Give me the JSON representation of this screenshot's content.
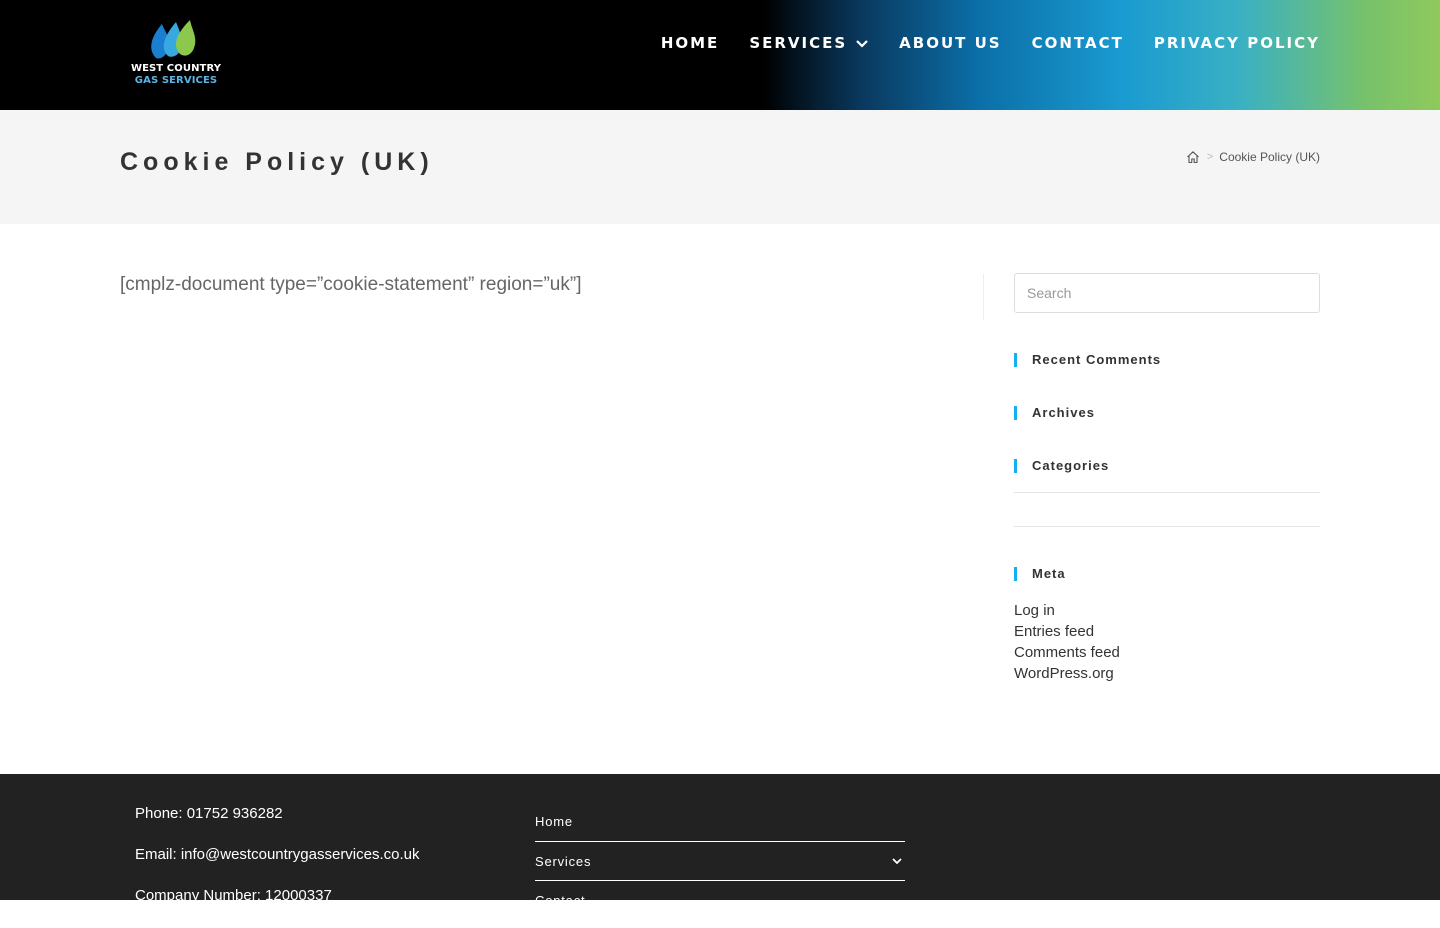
{
  "header": {
    "logo": {
      "line1": "WEST COUNTRY",
      "line2": "GAS SERVICES",
      "icon": "flame-logo-icon"
    },
    "nav": [
      {
        "label": "HOME"
      },
      {
        "label": "SERVICES",
        "icon": "chevron-down-icon"
      },
      {
        "label": "ABOUT US"
      },
      {
        "label": "CONTACT"
      },
      {
        "label": "PRIVACY POLICY"
      }
    ]
  },
  "title_bar": {
    "title": "Cookie Policy (UK)",
    "breadcrumb": {
      "home_icon": "home-icon",
      "separator": ">",
      "current": "Cookie Policy (UK)"
    }
  },
  "main": {
    "content": "[cmplz-document type=”cookie-statement” region=”uk”]"
  },
  "sidebar": {
    "search_placeholder": "Search",
    "widgets": {
      "recent_comments": "Recent Comments",
      "archives": "Archives",
      "categories": "Categories",
      "meta": "Meta"
    },
    "meta_links": [
      "Log in",
      "Entries feed",
      "Comments feed",
      "WordPress.org"
    ]
  },
  "footer": {
    "phone": "Phone: 01752 936282",
    "email": "Email: info@westcountrygasservices.co.uk",
    "company": "Company Number: 12000337",
    "menu": [
      {
        "label": "Home"
      },
      {
        "label": "Services",
        "icon": "chevron-down-icon"
      },
      {
        "label": "Contact"
      }
    ]
  },
  "colors": {
    "accent": "#13aff0",
    "footer_bg": "#222222",
    "title_bar_bg": "#f5f5f5"
  }
}
